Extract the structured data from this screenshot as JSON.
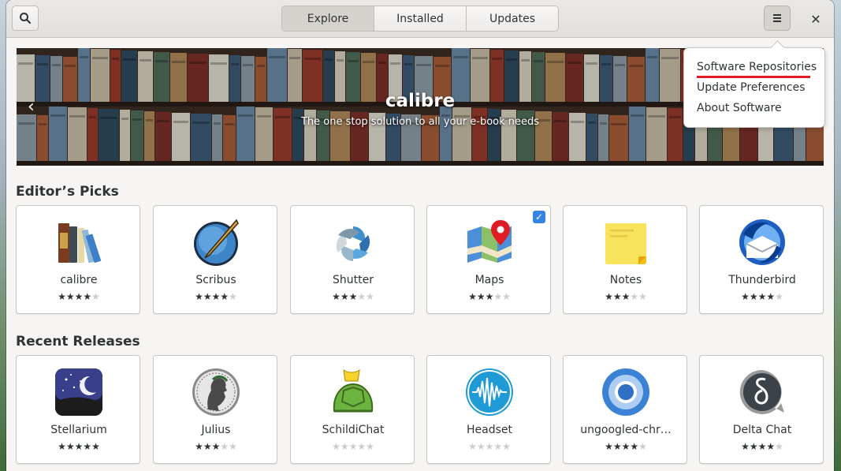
{
  "header": {
    "tabs": [
      "Explore",
      "Installed",
      "Updates"
    ],
    "active_tab": "Explore",
    "search_icon": "search-icon",
    "menu_icon": "hamburger-icon",
    "close_icon": "close-icon"
  },
  "banner": {
    "title": "calibre",
    "subtitle": "The one stop solution to all your e-book needs"
  },
  "menu": {
    "items": [
      "Software Repositories",
      "Update Preferences",
      "About Software"
    ],
    "highlight_color": "#e01b24"
  },
  "editors_picks": {
    "title": "Editor’s Picks",
    "apps": [
      {
        "name": "calibre",
        "rating": 4
      },
      {
        "name": "Scribus",
        "rating": 4
      },
      {
        "name": "Shutter",
        "rating": 3
      },
      {
        "name": "Maps",
        "rating": 3,
        "installed": true
      },
      {
        "name": "Notes",
        "rating": 3
      },
      {
        "name": "Thunderbird",
        "rating": 4
      }
    ]
  },
  "recent_releases": {
    "title": "Recent Releases",
    "apps": [
      {
        "name": "Stellarium",
        "rating": 5
      },
      {
        "name": "Julius",
        "rating": 3
      },
      {
        "name": "SchildiChat",
        "rating": 0
      },
      {
        "name": "Headset",
        "rating": 0
      },
      {
        "name": "ungoogled-chr…",
        "rating": 4
      },
      {
        "name": "Delta Chat",
        "rating": 4
      }
    ]
  },
  "colors": {
    "accent": "#3584e4"
  }
}
